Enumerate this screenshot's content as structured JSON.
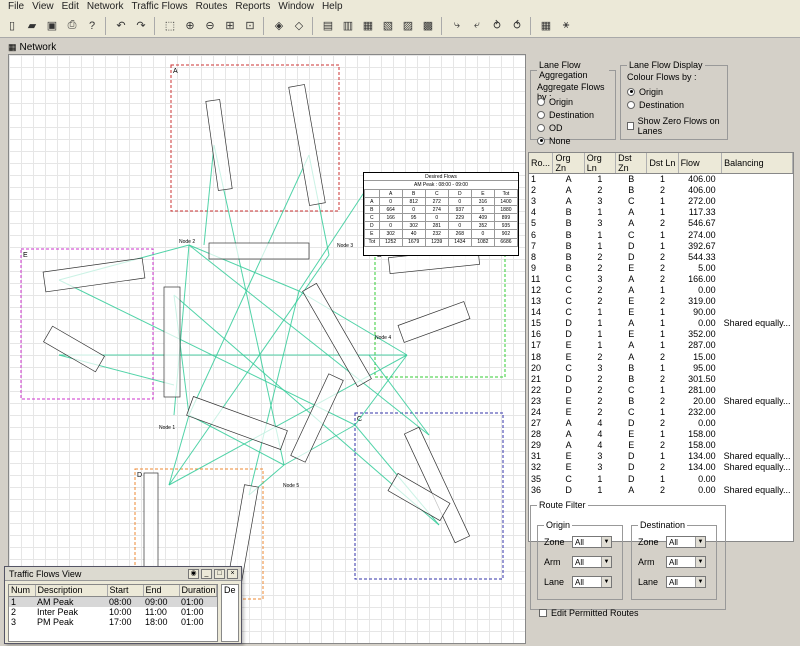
{
  "menu": [
    "File",
    "View",
    "Edit",
    "Network",
    "Traffic Flows",
    "Routes",
    "Reports",
    "Window",
    "Help"
  ],
  "panel_title": "Network",
  "lane_flow_aggregation": {
    "title": "Lane Flow Aggregation",
    "subtitle": "Aggregate Flows by :",
    "options": [
      "Origin",
      "Destination",
      "OD",
      "None"
    ],
    "selected": "None"
  },
  "lane_flow_display": {
    "title": "Lane Flow Display",
    "subtitle": "Colour Flows by :",
    "options": [
      "Origin",
      "Destination"
    ],
    "selected": "Origin",
    "show_zero_label": "Show Zero Flows on Lanes"
  },
  "routes_table": {
    "headers": [
      "Ro...",
      "Org Zn",
      "Org Ln",
      "Dst Zn",
      "Dst Ln",
      "Flow",
      "Balancing"
    ],
    "rows": [
      [
        "1",
        "A",
        "1",
        "B",
        "1",
        "406.00",
        ""
      ],
      [
        "2",
        "A",
        "2",
        "B",
        "2",
        "406.00",
        ""
      ],
      [
        "3",
        "A",
        "3",
        "C",
        "1",
        "272.00",
        ""
      ],
      [
        "4",
        "B",
        "1",
        "A",
        "1",
        "117.33",
        ""
      ],
      [
        "5",
        "B",
        "3",
        "A",
        "2",
        "546.67",
        ""
      ],
      [
        "6",
        "B",
        "1",
        "C",
        "1",
        "274.00",
        ""
      ],
      [
        "7",
        "B",
        "1",
        "D",
        "1",
        "392.67",
        ""
      ],
      [
        "8",
        "B",
        "2",
        "D",
        "2",
        "544.33",
        ""
      ],
      [
        "9",
        "B",
        "2",
        "E",
        "2",
        "5.00",
        ""
      ],
      [
        "11",
        "C",
        "3",
        "A",
        "2",
        "166.00",
        ""
      ],
      [
        "12",
        "C",
        "2",
        "A",
        "1",
        "0.00",
        ""
      ],
      [
        "13",
        "C",
        "2",
        "E",
        "2",
        "319.00",
        ""
      ],
      [
        "14",
        "C",
        "1",
        "E",
        "1",
        "90.00",
        ""
      ],
      [
        "15",
        "D",
        "1",
        "A",
        "1",
        "0.00",
        "Shared equally..."
      ],
      [
        "16",
        "D",
        "1",
        "E",
        "1",
        "352.00",
        ""
      ],
      [
        "17",
        "E",
        "1",
        "A",
        "1",
        "287.00",
        ""
      ],
      [
        "18",
        "E",
        "2",
        "A",
        "2",
        "15.00",
        ""
      ],
      [
        "20",
        "C",
        "3",
        "B",
        "1",
        "95.00",
        ""
      ],
      [
        "21",
        "D",
        "2",
        "B",
        "2",
        "301.50",
        ""
      ],
      [
        "22",
        "D",
        "2",
        "C",
        "1",
        "281.00",
        ""
      ],
      [
        "23",
        "E",
        "2",
        "B",
        "2",
        "20.00",
        "Shared equally..."
      ],
      [
        "24",
        "E",
        "2",
        "C",
        "1",
        "232.00",
        ""
      ],
      [
        "27",
        "A",
        "4",
        "D",
        "2",
        "0.00",
        ""
      ],
      [
        "28",
        "A",
        "4",
        "E",
        "1",
        "158.00",
        ""
      ],
      [
        "29",
        "A",
        "4",
        "E",
        "2",
        "158.00",
        ""
      ],
      [
        "31",
        "E",
        "3",
        "D",
        "1",
        "134.00",
        "Shared equally..."
      ],
      [
        "32",
        "E",
        "3",
        "D",
        "2",
        "134.00",
        "Shared equally..."
      ],
      [
        "35",
        "C",
        "1",
        "D",
        "1",
        "0.00",
        ""
      ],
      [
        "36",
        "D",
        "1",
        "A",
        "2",
        "0.00",
        "Shared equally..."
      ]
    ]
  },
  "route_filter": {
    "title": "Route Filter",
    "origin_title": "Origin",
    "destination_title": "Destination",
    "zone_label": "Zone",
    "arm_label": "Arm",
    "lane_label": "Lane",
    "all_value": "All",
    "edit_permitted_label": "Edit Permitted Routes"
  },
  "traffic_flows_view": {
    "title": "Traffic Flows View",
    "headers": [
      "Num",
      "Description",
      "Start",
      "End",
      "Duration"
    ],
    "rows": [
      [
        "1",
        "AM Peak",
        "08:00",
        "09:00",
        "01:00"
      ],
      [
        "2",
        "Inter Peak",
        "10:00",
        "11:00",
        "01:00"
      ],
      [
        "3",
        "PM Peak",
        "17:00",
        "18:00",
        "01:00"
      ]
    ],
    "side_label": "De"
  },
  "desired_flows": {
    "title": "Desired Flows",
    "subtitle": "AM Peak : 08:00 - 09:00",
    "headers": [
      "",
      "A",
      "B",
      "C",
      "D",
      "E",
      "Tot"
    ],
    "rows": [
      [
        "A",
        "0",
        "812",
        "272",
        "0",
        "316",
        "1400"
      ],
      [
        "B",
        "664",
        "0",
        "274",
        "937",
        "5",
        "1880"
      ],
      [
        "C",
        "166",
        "95",
        "0",
        "229",
        "409",
        "899"
      ],
      [
        "D",
        "0",
        "302",
        "281",
        "0",
        "352",
        "935"
      ],
      [
        "E",
        "302",
        "40",
        "232",
        "268",
        "0",
        "902"
      ],
      [
        "Tot",
        "1252",
        "1679",
        "1239",
        "1434",
        "1082",
        "6686"
      ]
    ]
  },
  "network": {
    "zone_labels": [
      "A",
      "B",
      "C",
      "D",
      "E"
    ],
    "node_labels": [
      "Node 1",
      "Node 2",
      "Node 3",
      "Node 4",
      "Node 5"
    ],
    "zone_colors": {
      "A": "#cc3333",
      "B": "#33cc33",
      "C": "#3333aa",
      "D": "#ee8833",
      "E": "#cc33cc"
    },
    "link_color": "#33cc99"
  }
}
